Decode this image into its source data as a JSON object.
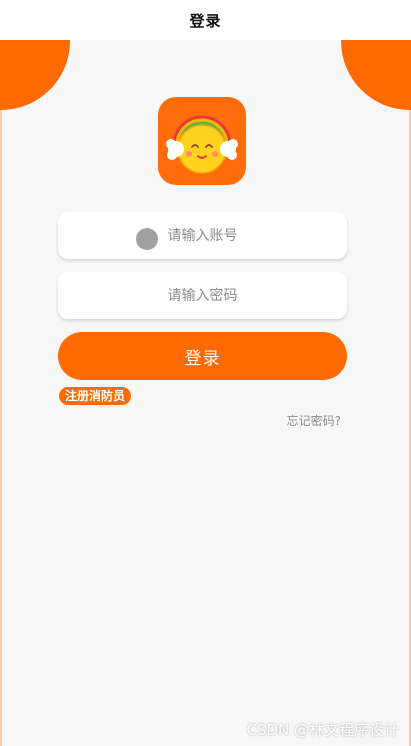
{
  "header": {
    "title": "登录"
  },
  "logo": {
    "icon": "sun-with-rainbow-headphones-icon",
    "bg_color": "#ff6d0a"
  },
  "form": {
    "account_placeholder": "请输入账号",
    "password_placeholder": "请输入密码",
    "login_label": "登录",
    "register_label": "注册消防员",
    "forgot_label": "忘记密码?"
  },
  "colors": {
    "accent": "#ff6a00",
    "background": "#f8f7f7"
  },
  "watermark": "CSDN @林文程序设计"
}
